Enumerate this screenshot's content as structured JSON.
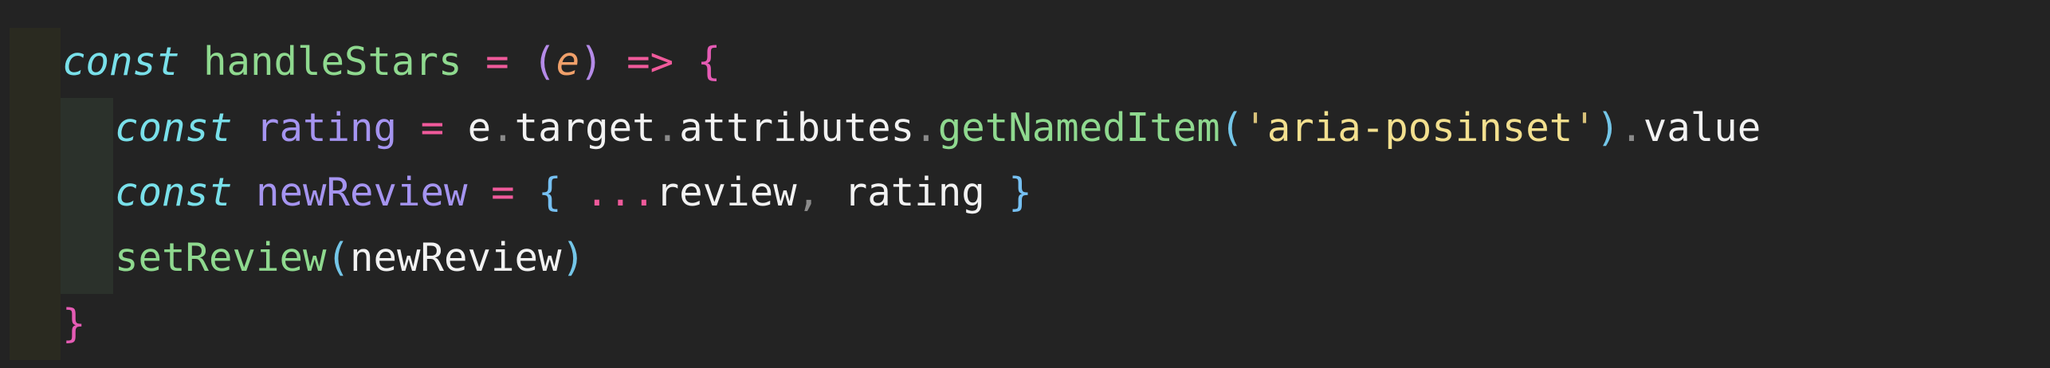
{
  "code": {
    "lines": [
      {
        "tokens": [
          {
            "text": "const",
            "kind": "keyword"
          },
          {
            "text": " ",
            "kind": "space"
          },
          {
            "text": "handleStars",
            "kind": "function"
          },
          {
            "text": " ",
            "kind": "space"
          },
          {
            "text": "=",
            "kind": "operator"
          },
          {
            "text": " ",
            "kind": "space"
          },
          {
            "text": "(",
            "kind": "paren"
          },
          {
            "text": "e",
            "kind": "param"
          },
          {
            "text": ")",
            "kind": "paren"
          },
          {
            "text": " ",
            "kind": "space"
          },
          {
            "text": "=>",
            "kind": "operator"
          },
          {
            "text": " ",
            "kind": "space"
          },
          {
            "text": "{",
            "kind": "brace"
          }
        ]
      },
      {
        "tokens": [
          {
            "text": "const",
            "kind": "keyword"
          },
          {
            "text": " ",
            "kind": "space"
          },
          {
            "text": "rating",
            "kind": "variable"
          },
          {
            "text": " ",
            "kind": "space"
          },
          {
            "text": "=",
            "kind": "operator"
          },
          {
            "text": " ",
            "kind": "space"
          },
          {
            "text": "e",
            "kind": "plain"
          },
          {
            "text": ".",
            "kind": "dot"
          },
          {
            "text": "target",
            "kind": "plain"
          },
          {
            "text": ".",
            "kind": "dot"
          },
          {
            "text": "attributes",
            "kind": "plain"
          },
          {
            "text": ".",
            "kind": "dot"
          },
          {
            "text": "getNamedItem",
            "kind": "function"
          },
          {
            "text": "(",
            "kind": "paren2"
          },
          {
            "text": "'",
            "kind": "quote"
          },
          {
            "text": "aria-posinset",
            "kind": "string"
          },
          {
            "text": "'",
            "kind": "quote"
          },
          {
            "text": ")",
            "kind": "paren2"
          },
          {
            "text": ".",
            "kind": "dot"
          },
          {
            "text": "value",
            "kind": "plain"
          }
        ]
      },
      {
        "tokens": [
          {
            "text": "const",
            "kind": "keyword"
          },
          {
            "text": " ",
            "kind": "space"
          },
          {
            "text": "newReview",
            "kind": "variable"
          },
          {
            "text": " ",
            "kind": "space"
          },
          {
            "text": "=",
            "kind": "operator"
          },
          {
            "text": " ",
            "kind": "space"
          },
          {
            "text": "{",
            "kind": "brace2"
          },
          {
            "text": " ",
            "kind": "space"
          },
          {
            "text": "...",
            "kind": "spread"
          },
          {
            "text": "review",
            "kind": "plain"
          },
          {
            "text": ",",
            "kind": "comma"
          },
          {
            "text": " ",
            "kind": "space"
          },
          {
            "text": "rating",
            "kind": "plain"
          },
          {
            "text": " ",
            "kind": "space"
          },
          {
            "text": "}",
            "kind": "brace2"
          }
        ]
      },
      {
        "tokens": [
          {
            "text": "setReview",
            "kind": "function"
          },
          {
            "text": "(",
            "kind": "paren2"
          },
          {
            "text": "newReview",
            "kind": "plain"
          },
          {
            "text": ")",
            "kind": "paren2"
          }
        ]
      },
      {
        "tokens": [
          {
            "text": "}",
            "kind": "brace"
          }
        ]
      }
    ]
  },
  "theme": {
    "background": "#232323",
    "keyword": "#79e0ea",
    "function": "#8fd98f",
    "operator": "#f05a9b",
    "string": "#f3e08f",
    "variable": "#a594f0"
  }
}
